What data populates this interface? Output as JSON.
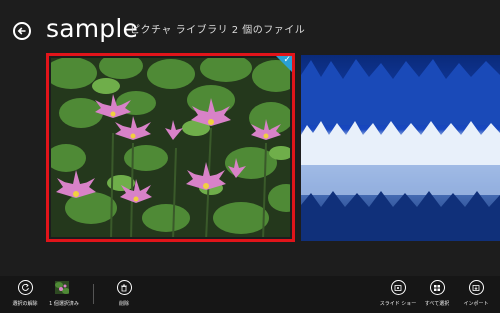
{
  "header": {
    "title": "sample",
    "subtitle": "ピクチャ ライブラリ 2 個のファイル"
  },
  "tiles": [
    {
      "name": "water-lily-photo",
      "selected": true
    },
    {
      "name": "winter-forest-photo",
      "selected": false
    }
  ],
  "appbar": {
    "clear_selection_label": "選択の解除",
    "selected_count_label": "1 個選択済み",
    "delete_label": "削除",
    "slideshow_label": "スライド ショー",
    "select_all_label": "すべて選択",
    "import_label": "インポート"
  },
  "colors": {
    "background": "#1d1d1d",
    "selection_border": "#e1141a",
    "check_accent": "#2aa0d6",
    "appbar": "#161616"
  }
}
